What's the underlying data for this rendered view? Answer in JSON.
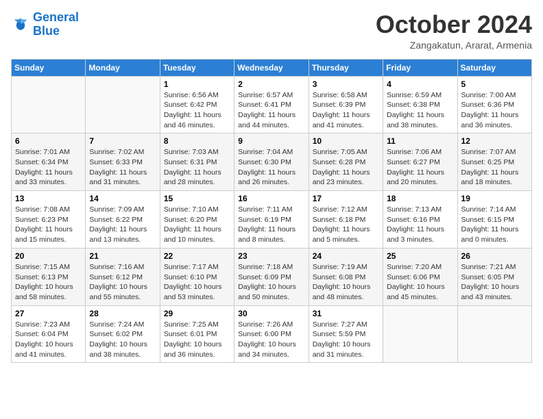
{
  "logo": {
    "line1": "General",
    "line2": "Blue"
  },
  "title": "October 2024",
  "subtitle": "Zangakatun, Ararat, Armenia",
  "headers": [
    "Sunday",
    "Monday",
    "Tuesday",
    "Wednesday",
    "Thursday",
    "Friday",
    "Saturday"
  ],
  "weeks": [
    [
      {
        "day": "",
        "sunrise": "",
        "sunset": "",
        "daylight": ""
      },
      {
        "day": "",
        "sunrise": "",
        "sunset": "",
        "daylight": ""
      },
      {
        "day": "1",
        "sunrise": "Sunrise: 6:56 AM",
        "sunset": "Sunset: 6:42 PM",
        "daylight": "Daylight: 11 hours and 46 minutes."
      },
      {
        "day": "2",
        "sunrise": "Sunrise: 6:57 AM",
        "sunset": "Sunset: 6:41 PM",
        "daylight": "Daylight: 11 hours and 44 minutes."
      },
      {
        "day": "3",
        "sunrise": "Sunrise: 6:58 AM",
        "sunset": "Sunset: 6:39 PM",
        "daylight": "Daylight: 11 hours and 41 minutes."
      },
      {
        "day": "4",
        "sunrise": "Sunrise: 6:59 AM",
        "sunset": "Sunset: 6:38 PM",
        "daylight": "Daylight: 11 hours and 38 minutes."
      },
      {
        "day": "5",
        "sunrise": "Sunrise: 7:00 AM",
        "sunset": "Sunset: 6:36 PM",
        "daylight": "Daylight: 11 hours and 36 minutes."
      }
    ],
    [
      {
        "day": "6",
        "sunrise": "Sunrise: 7:01 AM",
        "sunset": "Sunset: 6:34 PM",
        "daylight": "Daylight: 11 hours and 33 minutes."
      },
      {
        "day": "7",
        "sunrise": "Sunrise: 7:02 AM",
        "sunset": "Sunset: 6:33 PM",
        "daylight": "Daylight: 11 hours and 31 minutes."
      },
      {
        "day": "8",
        "sunrise": "Sunrise: 7:03 AM",
        "sunset": "Sunset: 6:31 PM",
        "daylight": "Daylight: 11 hours and 28 minutes."
      },
      {
        "day": "9",
        "sunrise": "Sunrise: 7:04 AM",
        "sunset": "Sunset: 6:30 PM",
        "daylight": "Daylight: 11 hours and 26 minutes."
      },
      {
        "day": "10",
        "sunrise": "Sunrise: 7:05 AM",
        "sunset": "Sunset: 6:28 PM",
        "daylight": "Daylight: 11 hours and 23 minutes."
      },
      {
        "day": "11",
        "sunrise": "Sunrise: 7:06 AM",
        "sunset": "Sunset: 6:27 PM",
        "daylight": "Daylight: 11 hours and 20 minutes."
      },
      {
        "day": "12",
        "sunrise": "Sunrise: 7:07 AM",
        "sunset": "Sunset: 6:25 PM",
        "daylight": "Daylight: 11 hours and 18 minutes."
      }
    ],
    [
      {
        "day": "13",
        "sunrise": "Sunrise: 7:08 AM",
        "sunset": "Sunset: 6:23 PM",
        "daylight": "Daylight: 11 hours and 15 minutes."
      },
      {
        "day": "14",
        "sunrise": "Sunrise: 7:09 AM",
        "sunset": "Sunset: 6:22 PM",
        "daylight": "Daylight: 11 hours and 13 minutes."
      },
      {
        "day": "15",
        "sunrise": "Sunrise: 7:10 AM",
        "sunset": "Sunset: 6:20 PM",
        "daylight": "Daylight: 11 hours and 10 minutes."
      },
      {
        "day": "16",
        "sunrise": "Sunrise: 7:11 AM",
        "sunset": "Sunset: 6:19 PM",
        "daylight": "Daylight: 11 hours and 8 minutes."
      },
      {
        "day": "17",
        "sunrise": "Sunrise: 7:12 AM",
        "sunset": "Sunset: 6:18 PM",
        "daylight": "Daylight: 11 hours and 5 minutes."
      },
      {
        "day": "18",
        "sunrise": "Sunrise: 7:13 AM",
        "sunset": "Sunset: 6:16 PM",
        "daylight": "Daylight: 11 hours and 3 minutes."
      },
      {
        "day": "19",
        "sunrise": "Sunrise: 7:14 AM",
        "sunset": "Sunset: 6:15 PM",
        "daylight": "Daylight: 11 hours and 0 minutes."
      }
    ],
    [
      {
        "day": "20",
        "sunrise": "Sunrise: 7:15 AM",
        "sunset": "Sunset: 6:13 PM",
        "daylight": "Daylight: 10 hours and 58 minutes."
      },
      {
        "day": "21",
        "sunrise": "Sunrise: 7:16 AM",
        "sunset": "Sunset: 6:12 PM",
        "daylight": "Daylight: 10 hours and 55 minutes."
      },
      {
        "day": "22",
        "sunrise": "Sunrise: 7:17 AM",
        "sunset": "Sunset: 6:10 PM",
        "daylight": "Daylight: 10 hours and 53 minutes."
      },
      {
        "day": "23",
        "sunrise": "Sunrise: 7:18 AM",
        "sunset": "Sunset: 6:09 PM",
        "daylight": "Daylight: 10 hours and 50 minutes."
      },
      {
        "day": "24",
        "sunrise": "Sunrise: 7:19 AM",
        "sunset": "Sunset: 6:08 PM",
        "daylight": "Daylight: 10 hours and 48 minutes."
      },
      {
        "day": "25",
        "sunrise": "Sunrise: 7:20 AM",
        "sunset": "Sunset: 6:06 PM",
        "daylight": "Daylight: 10 hours and 45 minutes."
      },
      {
        "day": "26",
        "sunrise": "Sunrise: 7:21 AM",
        "sunset": "Sunset: 6:05 PM",
        "daylight": "Daylight: 10 hours and 43 minutes."
      }
    ],
    [
      {
        "day": "27",
        "sunrise": "Sunrise: 7:23 AM",
        "sunset": "Sunset: 6:04 PM",
        "daylight": "Daylight: 10 hours and 41 minutes."
      },
      {
        "day": "28",
        "sunrise": "Sunrise: 7:24 AM",
        "sunset": "Sunset: 6:02 PM",
        "daylight": "Daylight: 10 hours and 38 minutes."
      },
      {
        "day": "29",
        "sunrise": "Sunrise: 7:25 AM",
        "sunset": "Sunset: 6:01 PM",
        "daylight": "Daylight: 10 hours and 36 minutes."
      },
      {
        "day": "30",
        "sunrise": "Sunrise: 7:26 AM",
        "sunset": "Sunset: 6:00 PM",
        "daylight": "Daylight: 10 hours and 34 minutes."
      },
      {
        "day": "31",
        "sunrise": "Sunrise: 7:27 AM",
        "sunset": "Sunset: 5:59 PM",
        "daylight": "Daylight: 10 hours and 31 minutes."
      },
      {
        "day": "",
        "sunrise": "",
        "sunset": "",
        "daylight": ""
      },
      {
        "day": "",
        "sunrise": "",
        "sunset": "",
        "daylight": ""
      }
    ]
  ]
}
